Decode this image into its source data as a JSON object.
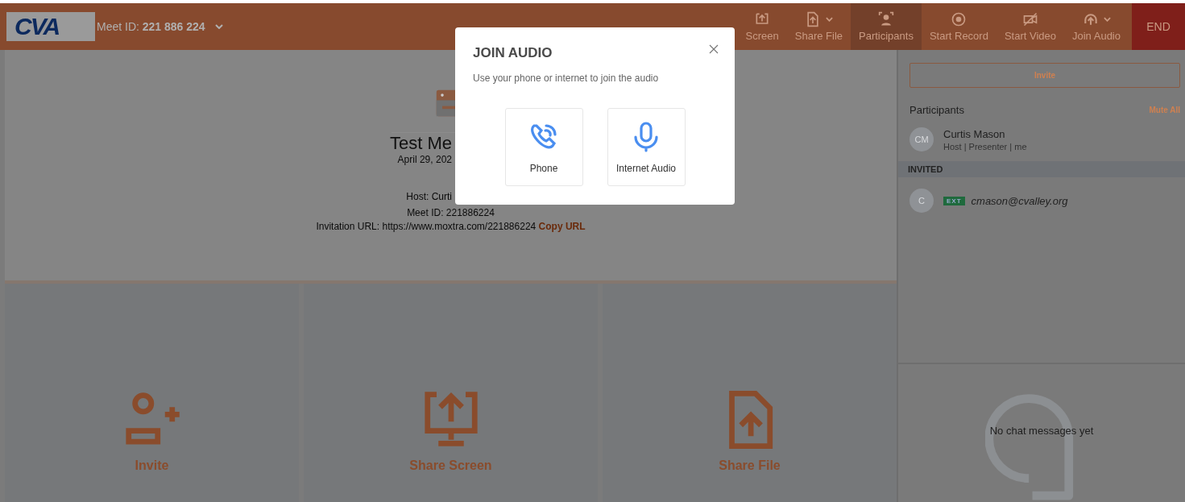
{
  "header": {
    "logo": "CVA",
    "meet_id_label": "Meet ID:",
    "meet_id": "221 886 224"
  },
  "toolbar": [
    {
      "label": "Screen",
      "kind": "screen",
      "has_menu": false,
      "selected": false
    },
    {
      "label": "Share File",
      "kind": "file",
      "has_menu": true,
      "selected": false
    },
    {
      "label": "Participants",
      "kind": "people",
      "has_menu": false,
      "selected": true
    },
    {
      "label": "Start Record",
      "kind": "record",
      "has_menu": false,
      "selected": false
    },
    {
      "label": "Start Video",
      "kind": "video",
      "has_menu": false,
      "selected": false
    },
    {
      "label": "Join Audio",
      "kind": "audio",
      "has_menu": true,
      "selected": false
    }
  ],
  "end_button": "END",
  "meeting": {
    "title": "Test Me",
    "date": "April 29, 202",
    "host": "Host: Curti",
    "meet_id": "Meet ID: 221886224",
    "invitation": "Invitation URL: https://www.moxtra.com/221886224",
    "copy_link": "Copy URL"
  },
  "tiles": [
    {
      "label": "Invite",
      "kind": "invite"
    },
    {
      "label": "Share Screen",
      "kind": "screen"
    },
    {
      "label": "Share File",
      "kind": "file"
    }
  ],
  "panel": {
    "invite_button": "Invite",
    "participants_title": "Participants",
    "mute_all": "Mute All",
    "participants": [
      {
        "initials": "CM",
        "name": "Curtis Mason",
        "role": "Host | Presenter | me"
      }
    ],
    "invited_label": "INVITED",
    "invited": [
      {
        "initials": "C",
        "badge": "EXT",
        "email": "cmason@cvalley.org"
      }
    ],
    "chat_empty": "No chat messages yet"
  },
  "dialog": {
    "title": "JOIN AUDIO",
    "message": "Use your phone or internet to join the audio",
    "options": [
      {
        "label": "Phone",
        "kind": "phone"
      },
      {
        "label": "Internet Audio",
        "kind": "internet"
      }
    ]
  }
}
